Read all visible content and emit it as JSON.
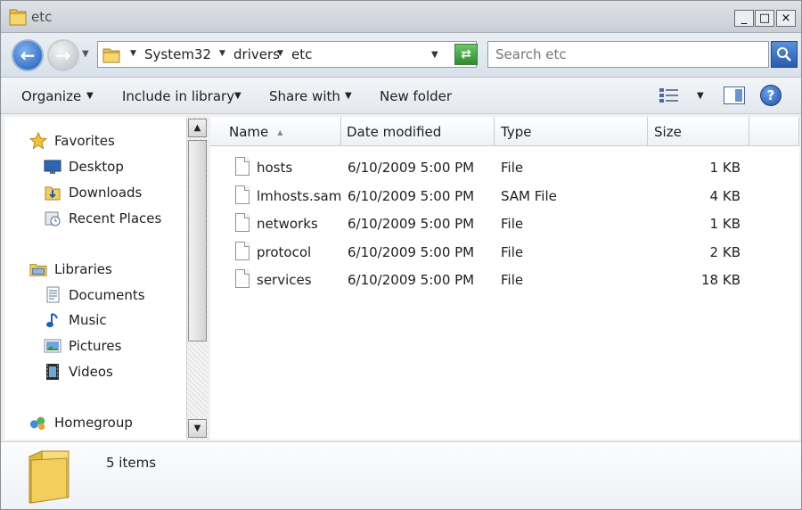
{
  "window": {
    "title": "etc",
    "minimize_glyph": "_",
    "maximize_glyph": "□",
    "close_glyph": "×"
  },
  "navigation": {
    "back_icon": "back-arrow-icon",
    "forward_icon": "forward-arrow-icon",
    "breadcrumb": [
      "System32",
      "drivers",
      "etc"
    ],
    "search_placeholder": "Search etc"
  },
  "toolbar": {
    "organize": "Organize",
    "include_in_library": "Include in library",
    "share_with": "Share with",
    "new_folder": "New folder"
  },
  "sidebar": {
    "favorites": {
      "label": "Favorites",
      "items": [
        "Desktop",
        "Downloads",
        "Recent Places"
      ]
    },
    "libraries": {
      "label": "Libraries",
      "items": [
        "Documents",
        "Music",
        "Pictures",
        "Videos"
      ]
    },
    "homegroup": "Homegroup"
  },
  "file_list": {
    "columns": [
      "Name",
      "Date modified",
      "Type",
      "Size"
    ],
    "sort_column": "Name",
    "rows": [
      {
        "name": "hosts",
        "date": "6/10/2009 5:00 PM",
        "type": "File",
        "size": "1 KB"
      },
      {
        "name": "lmhosts.sam",
        "date": "6/10/2009 5:00 PM",
        "type": "SAM File",
        "size": "4 KB"
      },
      {
        "name": "networks",
        "date": "6/10/2009 5:00 PM",
        "type": "File",
        "size": "1 KB"
      },
      {
        "name": "protocol",
        "date": "6/10/2009 5:00 PM",
        "type": "File",
        "size": "2 KB"
      },
      {
        "name": "services",
        "date": "6/10/2009 5:00 PM",
        "type": "File",
        "size": "18 KB"
      }
    ]
  },
  "status": {
    "items_count": "5 items"
  },
  "colors": {
    "folder": "#f2cf5a",
    "accent": "#1f5cb8"
  }
}
